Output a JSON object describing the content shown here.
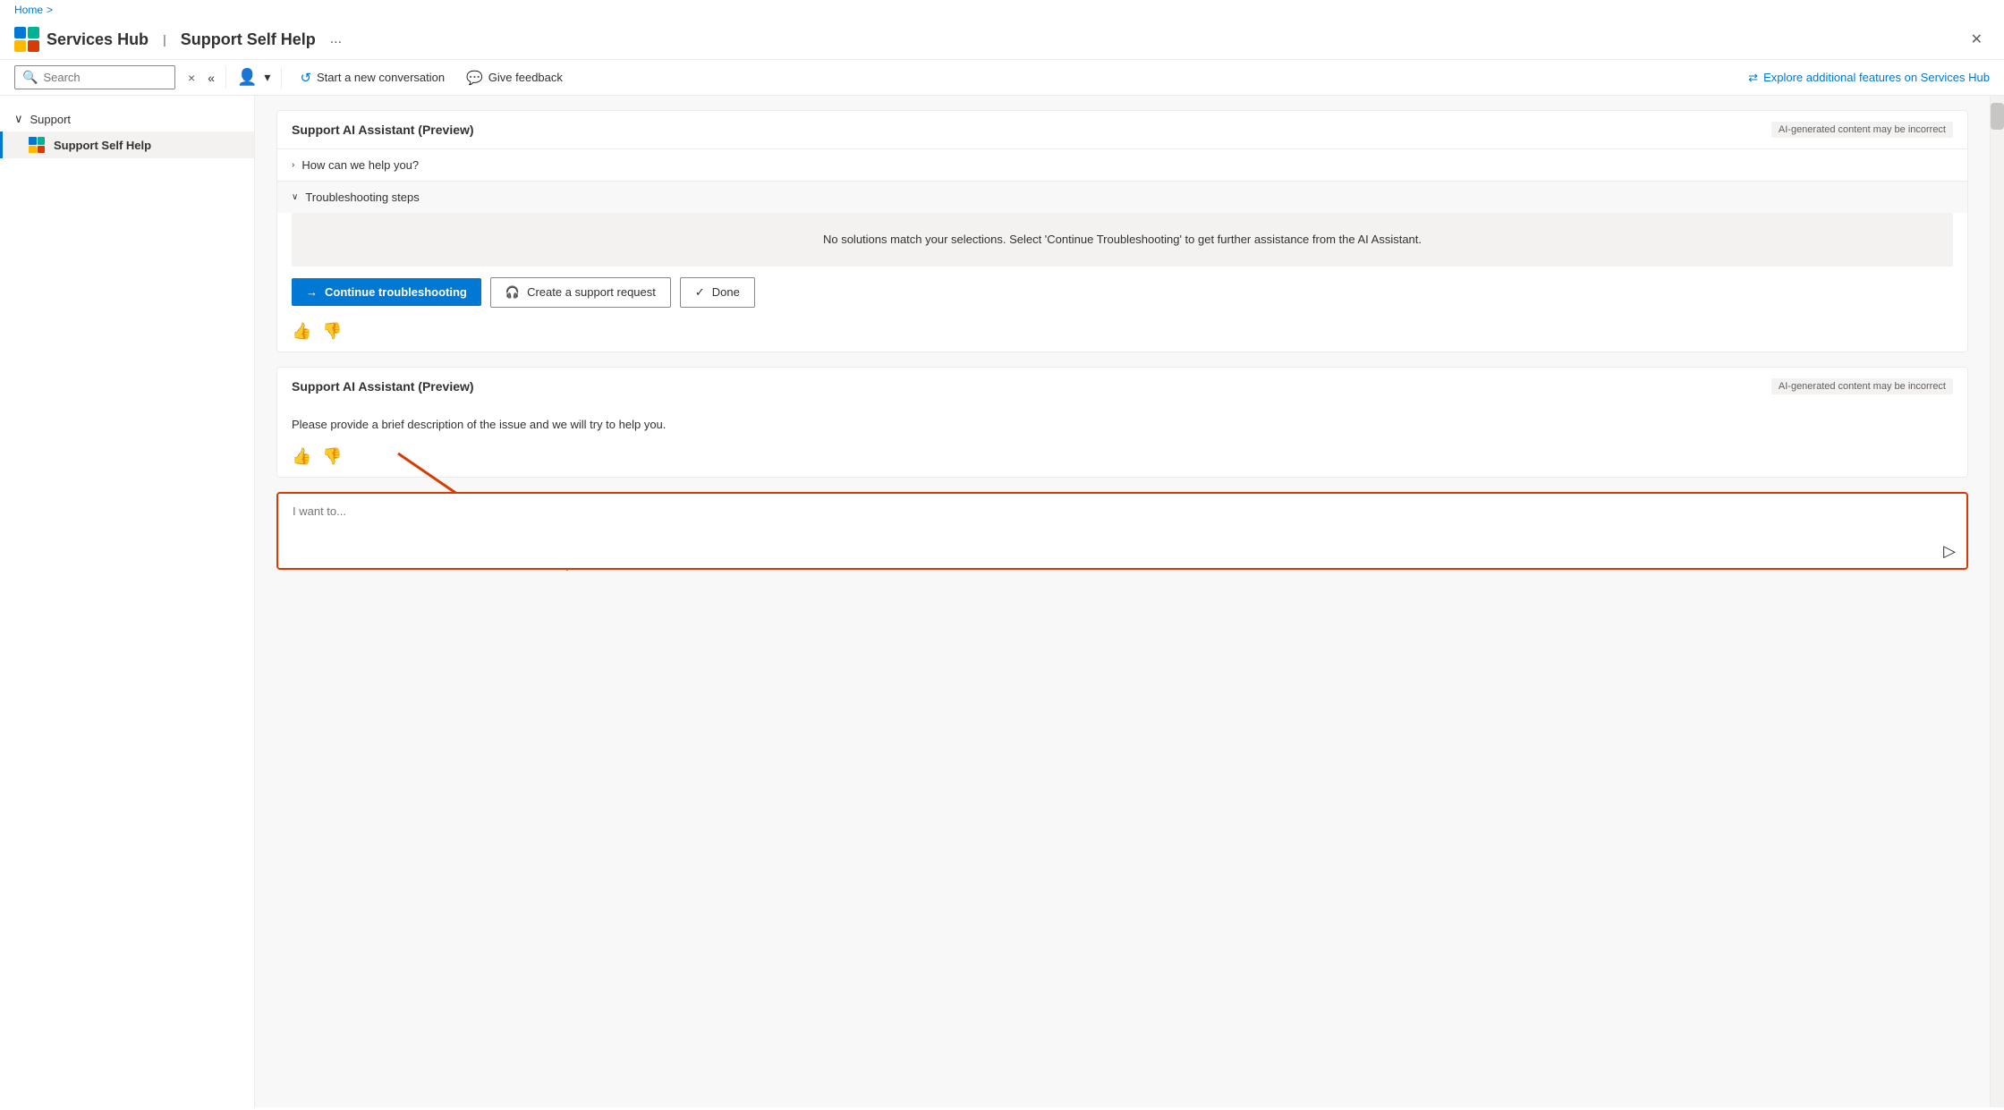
{
  "breadcrumb": {
    "home": "Home",
    "sep": ">"
  },
  "header": {
    "logo_alt": "Services Hub logo",
    "title": "Services Hub",
    "separator": "|",
    "subtitle": "Support Self Help",
    "ellipsis": "...",
    "close": "✕"
  },
  "toolbar": {
    "search_placeholder": "Search",
    "clear_label": "×",
    "collapse_label": "«",
    "start_conversation_label": "Start a new conversation",
    "give_feedback_label": "Give feedback",
    "explore_label": "Explore additional features on Services Hub"
  },
  "sidebar": {
    "group_label": "Support",
    "items": [
      {
        "label": "Support Self Help",
        "active": true
      }
    ]
  },
  "chat": [
    {
      "id": "card1",
      "title": "Support AI Assistant (Preview)",
      "disclaimer": "AI-generated content may be incorrect",
      "sections": [
        {
          "label": "How can we help you?",
          "collapsed": true,
          "chevron": "›"
        },
        {
          "label": "Troubleshooting steps",
          "collapsed": false,
          "chevron": "∨",
          "body": "No solutions match your selections. Select 'Continue Troubleshooting' to get further assistance from the AI Assistant."
        }
      ],
      "actions": [
        {
          "type": "primary",
          "label": "Continue troubleshooting",
          "icon": "→"
        },
        {
          "type": "secondary",
          "label": "Create a support request",
          "icon": "🎧"
        },
        {
          "type": "secondary",
          "label": "Done",
          "icon": "✓"
        }
      ],
      "feedback": {
        "thumbs_up": "👍",
        "thumbs_down": "👎"
      }
    },
    {
      "id": "card2",
      "title": "Support AI Assistant (Preview)",
      "disclaimer": "AI-generated content may be incorrect",
      "description": "Please provide a brief description of the issue and we will try to help you.",
      "feedback": {
        "thumbs_up": "👍",
        "thumbs_down": "👎"
      }
    }
  ],
  "input": {
    "placeholder": "I want to...",
    "send_icon": "▷"
  }
}
